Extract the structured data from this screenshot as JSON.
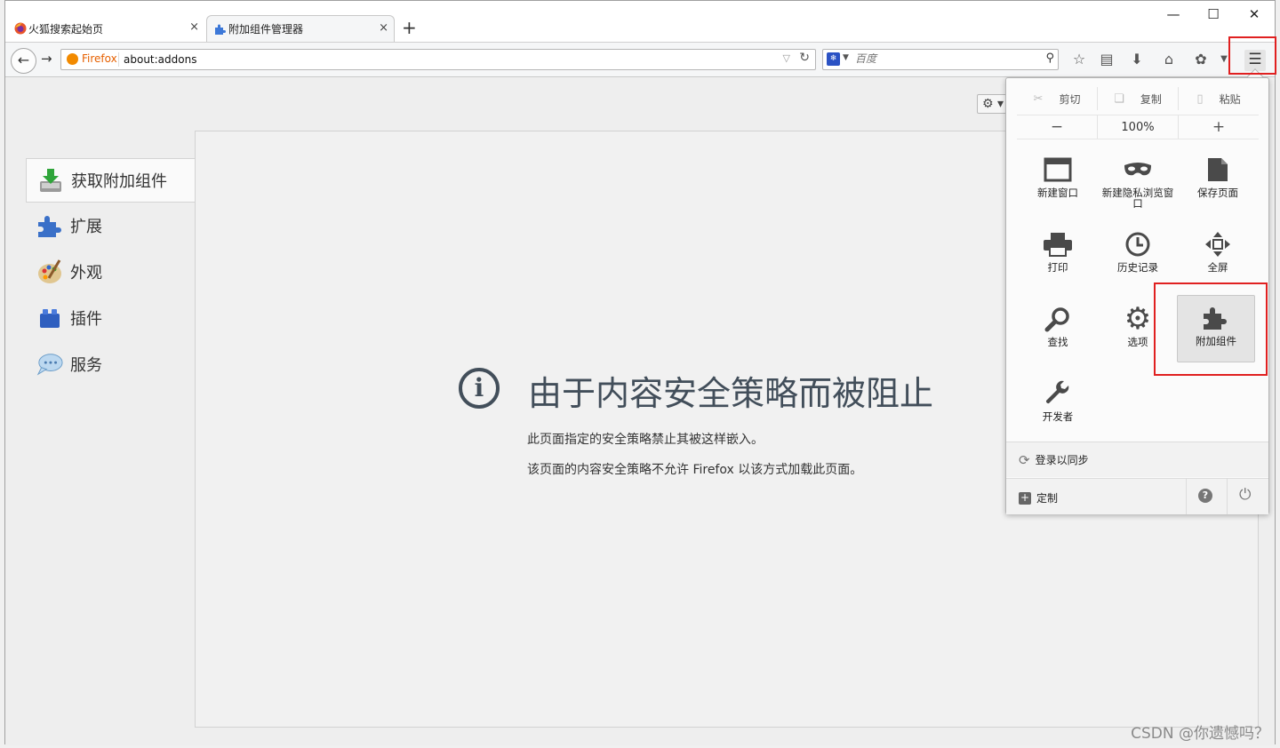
{
  "tabs": [
    {
      "label": "火狐搜索起始页",
      "close": "×",
      "active": false
    },
    {
      "label": "附加组件管理器",
      "close": "×",
      "active": true
    }
  ],
  "new_tab": "+",
  "window_controls": {
    "minimize": "—",
    "maximize": "☐",
    "close": "✕"
  },
  "navbar": {
    "identity_label": "Firefox",
    "url": "about:addons",
    "search_engine_icon": "baidu-paw-icon",
    "search_placeholder": "百度"
  },
  "toolbar_icons": [
    "bookmark-star-icon",
    "reading-list-icon",
    "download-icon",
    "home-icon",
    "extension-icon",
    "overflow-icon",
    "hamburger-menu-icon"
  ],
  "categories": [
    {
      "label": "获取附加组件",
      "icon": "get-addons-icon",
      "selected": true
    },
    {
      "label": "扩展",
      "icon": "puzzle-piece-icon",
      "selected": false
    },
    {
      "label": "外观",
      "icon": "palette-icon",
      "selected": false
    },
    {
      "label": "插件",
      "icon": "lego-block-icon",
      "selected": false
    },
    {
      "label": "服务",
      "icon": "chat-bubble-icon",
      "selected": false
    }
  ],
  "blocked": {
    "title": "由于内容安全策略而被阻止",
    "line1": "此页面指定的安全策略禁止其被这样嵌入。",
    "line2": "该页面的内容安全策略不允许 Firefox 以该方式加载此页面。"
  },
  "menu": {
    "edit": {
      "cut": "剪切",
      "copy": "复制",
      "paste": "粘贴"
    },
    "zoom": {
      "minus": "−",
      "level": "100%",
      "plus": "+"
    },
    "items": [
      {
        "label": "新建窗口",
        "icon": "new-window-icon"
      },
      {
        "label": "新建隐私浏览窗口",
        "icon": "private-mask-icon"
      },
      {
        "label": "保存页面",
        "icon": "save-page-icon"
      },
      {
        "label": "打印",
        "icon": "printer-icon"
      },
      {
        "label": "历史记录",
        "icon": "history-clock-icon"
      },
      {
        "label": "全屏",
        "icon": "fullscreen-icon"
      },
      {
        "label": "查找",
        "icon": "magnifier-icon"
      },
      {
        "label": "选项",
        "icon": "gear-icon"
      },
      {
        "label": "附加组件",
        "icon": "addons-puzzle-icon",
        "highlighted": true
      },
      {
        "label": "开发者",
        "icon": "wrench-icon"
      }
    ],
    "sync": "登录以同步",
    "customize": "定制"
  },
  "colors": {
    "highlight_box": "#e02020",
    "heading": "#424e5a",
    "firefox_orange": "#e66000"
  },
  "watermark": "CSDN @你遗憾吗？"
}
